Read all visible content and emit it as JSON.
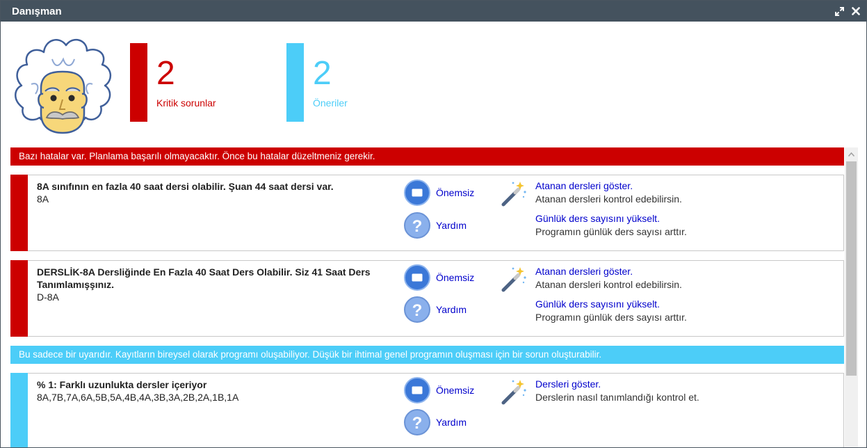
{
  "window": {
    "title": "Danışman",
    "icons": [
      "expand-icon",
      "close-icon"
    ]
  },
  "stats": {
    "critical": {
      "count": "2",
      "label": "Kritik sorunlar",
      "color": "#cc0000"
    },
    "suggestions": {
      "count": "2",
      "label": "Öneriler",
      "color": "#4ccdf8"
    }
  },
  "error_banner": "Bazı hatalar var. Planlama başarılı olmayacaktır. Önce bu hatalar düzeltmeniz gerekir.",
  "warning_banner": "Bu sadece bir uyarıdır. Kayıtların bireysel olarak programı oluşabiliyor. Düşük bir ihtimal genel programın oluşması için bir sorun oluşturabilir.",
  "errors": [
    {
      "title": "8A sınıfının en fazla 40 saat dersi olabilir. Şuan 44 saat dersi var.",
      "detail": "8A",
      "dismiss_label": "Önemsiz",
      "help_label": "Yardım",
      "actions": [
        {
          "link": "Atanan dersleri göster.",
          "desc": "Atanan dersleri kontrol edebilirsin."
        },
        {
          "link": "Günlük ders sayısını yükselt.",
          "desc": "Programın günlük ders sayısı arttır."
        }
      ]
    },
    {
      "title": "DERSLİK-8A Dersliğinde En Fazla 40 Saat Ders Olabilir. Siz 41 Saat Ders Tanımlamışşınız.",
      "detail": "D-8A",
      "dismiss_label": "Önemsiz",
      "help_label": "Yardım",
      "actions": [
        {
          "link": "Atanan dersleri göster.",
          "desc": "Atanan dersleri kontrol edebilirsin."
        },
        {
          "link": "Günlük ders sayısını yükselt.",
          "desc": "Programın günlük ders sayısı arttır."
        }
      ]
    }
  ],
  "warnings": [
    {
      "title": "% 1: Farklı uzunlukta dersler içeriyor",
      "detail": "8A,7B,7A,6A,5B,5A,4B,4A,3B,3A,2B,2A,1B,1A",
      "dismiss_label": "Önemsiz",
      "help_label": "Yardım",
      "actions": [
        {
          "link": "Dersleri göster.",
          "desc": "Derslerin nasıl tanımlandığı kontrol et."
        }
      ]
    }
  ]
}
